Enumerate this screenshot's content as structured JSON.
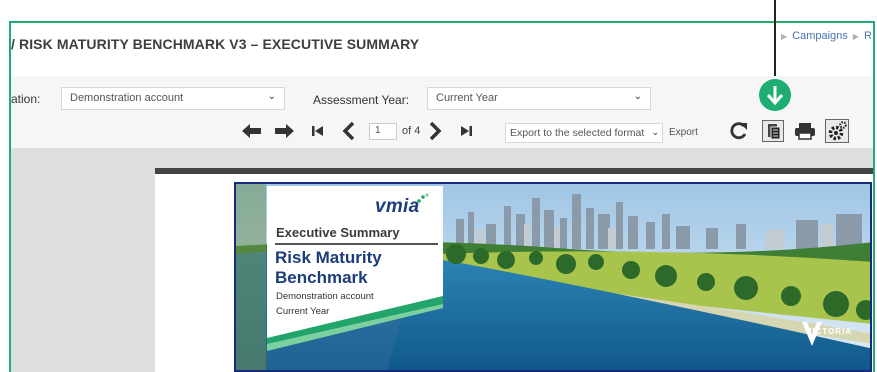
{
  "header": {
    "title": "/ RISK MATURITY BENCHMARK V3 – EXECUTIVE SUMMARY",
    "breadcrumbs": [
      "Campaigns",
      "R"
    ]
  },
  "filters": {
    "organisation_label": "ation:",
    "organisation_value": "Demonstration account",
    "year_label": "Assessment Year:",
    "year_value": "Current Year"
  },
  "toolbar": {
    "current_page": "1",
    "total_pages_label": "of 4",
    "export_format_value": "Export to the selected format",
    "export_label": "Export"
  },
  "report": {
    "logo_text": "vmia",
    "section_title": "Executive Summary",
    "report_title_line1": "Risk Maturity",
    "report_title_line2": "Benchmark",
    "account": "Demonstration account",
    "year": "Current Year",
    "govt_logo": "VICTORIA"
  },
  "icons": {
    "prev": "arrow-left-icon",
    "next": "arrow-right-icon",
    "first": "first-page-icon",
    "back": "chevron-left-icon",
    "fwd": "chevron-right-icon",
    "last": "last-page-icon",
    "refresh": "refresh-icon",
    "doc": "document-layout-icon",
    "print": "print-icon",
    "settings": "settings-icon",
    "callout": "arrow-down-callout-icon"
  },
  "colors": {
    "accent_green": "#1fae72",
    "brand_navy": "#1d3c7c",
    "link_blue": "#4a73b6"
  }
}
